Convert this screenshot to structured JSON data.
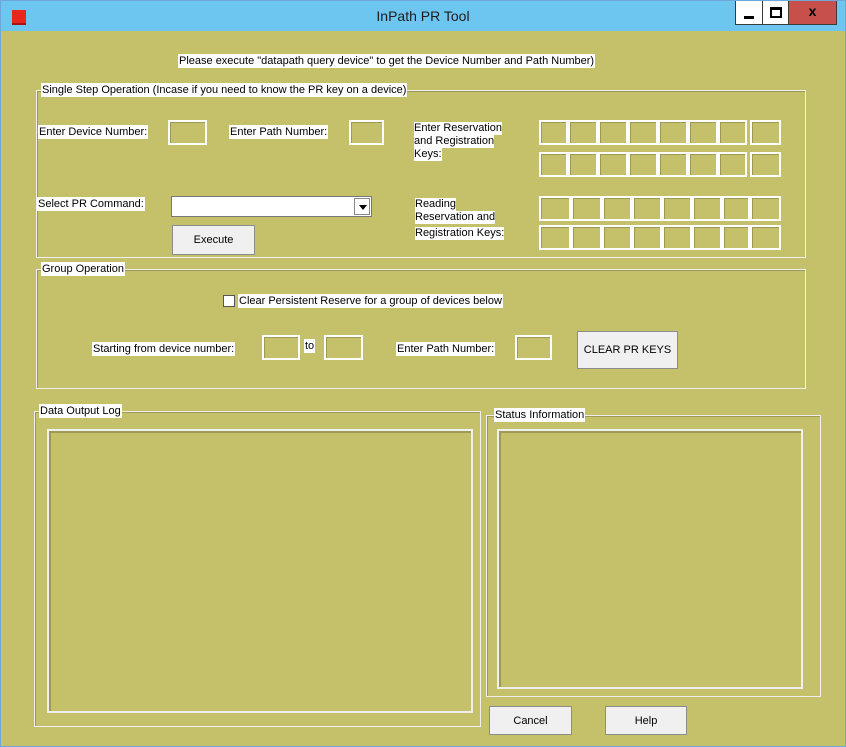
{
  "window": {
    "title": "InPath PR Tool"
  },
  "instruction": "Please execute \"datapath query device\"  to get the Device Number and Path Number)",
  "single_step": {
    "legend": "Single Step Operation (Incase if you need to know the PR key on a device)",
    "device_label": "Enter Device Number:",
    "path_label": "Enter Path Number:",
    "keys_label_1": "Enter Reservation",
    "keys_label_2": "and Registration",
    "keys_label_3": "Keys:",
    "command_label": "Select PR Command:",
    "command_value": "",
    "execute_label": "Execute",
    "reading_label_1": "Reading",
    "reading_label_2": "Reservation and",
    "reading_label_3": "Registration Keys:"
  },
  "group_op": {
    "legend": "Group Operation",
    "checkbox_label": "Clear Persistent Reserve for a group of devices below",
    "checkbox_checked": false,
    "start_label": "Starting from device number:",
    "to_label": "to",
    "path_label": "Enter Path Number:",
    "clear_button": "CLEAR PR KEYS"
  },
  "output": {
    "legend": "Data Output Log"
  },
  "status": {
    "legend": "Status Information"
  },
  "footer": {
    "cancel": "Cancel",
    "help": "Help"
  },
  "colors": {
    "background": "#c5c16a",
    "titlebar": "#6cc6f0",
    "close_button": "#c7514a"
  }
}
